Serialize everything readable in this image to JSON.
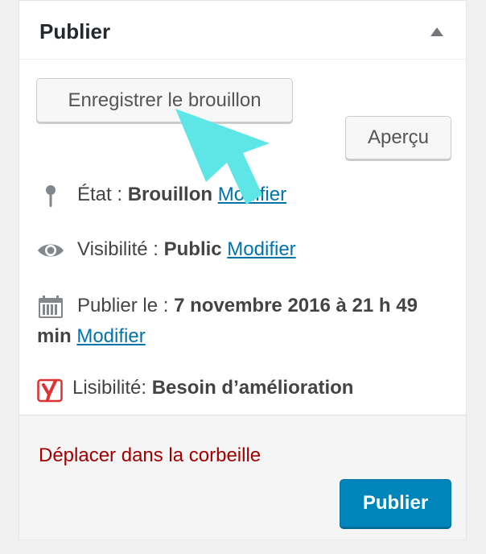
{
  "panel": {
    "title": "Publier",
    "collapse_icon": "triangle-up-icon"
  },
  "actions": {
    "save_draft_label": "Enregistrer le brouillon",
    "preview_label": "Aperçu"
  },
  "status": {
    "icon": "pin-icon",
    "label": "État : ",
    "value": "Brouillon",
    "edit_link": "Modifier"
  },
  "visibility": {
    "icon": "eye-icon",
    "label": "Visibilité : ",
    "value": "Public",
    "edit_link": "Modifier"
  },
  "schedule": {
    "icon": "calendar-icon",
    "label": "Publier le : ",
    "value": "7 novembre 2016 à 21 h 49 min",
    "edit_link": "Modifier"
  },
  "readability": {
    "icon": "yoast-icon",
    "label": "Lisibilité: ",
    "value": "Besoin d’amélioration"
  },
  "footer": {
    "trash_link": "Déplacer dans la corbeille",
    "publish_label": "Publier"
  },
  "colors": {
    "primary": "#0085ba",
    "link": "#0073aa",
    "danger": "#a00000",
    "cursor": "#5ee6e6",
    "yoast_red": "#dc3232"
  }
}
